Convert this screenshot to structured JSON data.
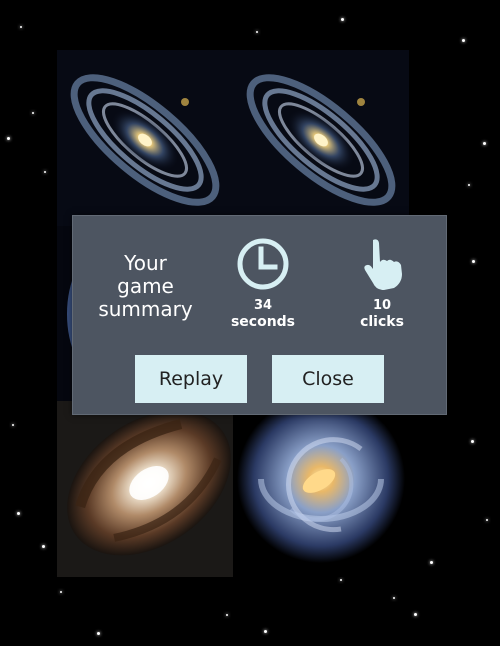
{
  "summary": {
    "title_line1": "Your",
    "title_line2": "game",
    "title_line3": "summary",
    "time_value": "34",
    "time_unit": "seconds",
    "clicks_value": "10",
    "clicks_unit": "clicks",
    "clock_icon": "clock-icon",
    "hand_icon": "pointing-hand-icon"
  },
  "buttons": {
    "replay": "Replay",
    "close": "Close"
  },
  "cards": [
    {
      "name": "andromeda-galaxy",
      "state": "revealed"
    },
    {
      "name": "andromeda-galaxy",
      "state": "revealed"
    },
    {
      "name": "spiral-galaxy-blue",
      "state": "revealed"
    },
    {
      "name": "spiral-galaxy-blue",
      "state": "revealed"
    },
    {
      "name": "black-eye-galaxy",
      "state": "revealed"
    },
    {
      "name": "milky-way-galaxy",
      "state": "revealed"
    }
  ],
  "colors": {
    "background": "#000000",
    "modal": "#4d5561",
    "button": "#d7eff3"
  }
}
